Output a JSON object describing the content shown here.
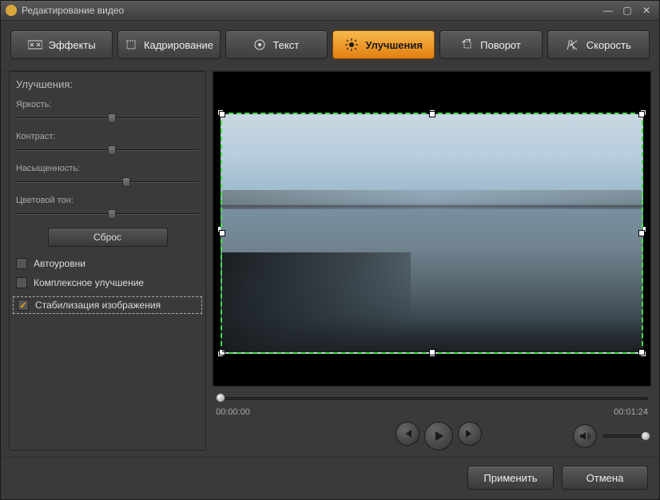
{
  "window": {
    "title": "Редактирование видео"
  },
  "tabs": {
    "effects": "Эффекты",
    "crop": "Кадрирование",
    "text": "Текст",
    "enhance": "Улучшения",
    "rotate": "Поворот",
    "speed": "Скорость"
  },
  "sidebar": {
    "heading": "Улучшения:",
    "brightness_label": "Яркость:",
    "contrast_label": "Контраст:",
    "saturation_label": "Насыщенность:",
    "hue_label": "Цветовой тон:",
    "reset_label": "Сброс",
    "auto_levels_label": "Автоуровни",
    "complex_enhance_label": "Комплексное улучшение",
    "stabilization_label": "Стабилизация изображения",
    "slider_positions": {
      "brightness": 50,
      "contrast": 50,
      "saturation": 58,
      "hue": 50
    },
    "checks": {
      "auto_levels": false,
      "complex_enhance": false,
      "stabilization": true
    }
  },
  "player": {
    "current_time": "00:00:00",
    "duration": "00:01:24",
    "position_percent": 0,
    "volume_percent": 100
  },
  "footer": {
    "apply_label": "Применить",
    "cancel_label": "Отмена"
  }
}
